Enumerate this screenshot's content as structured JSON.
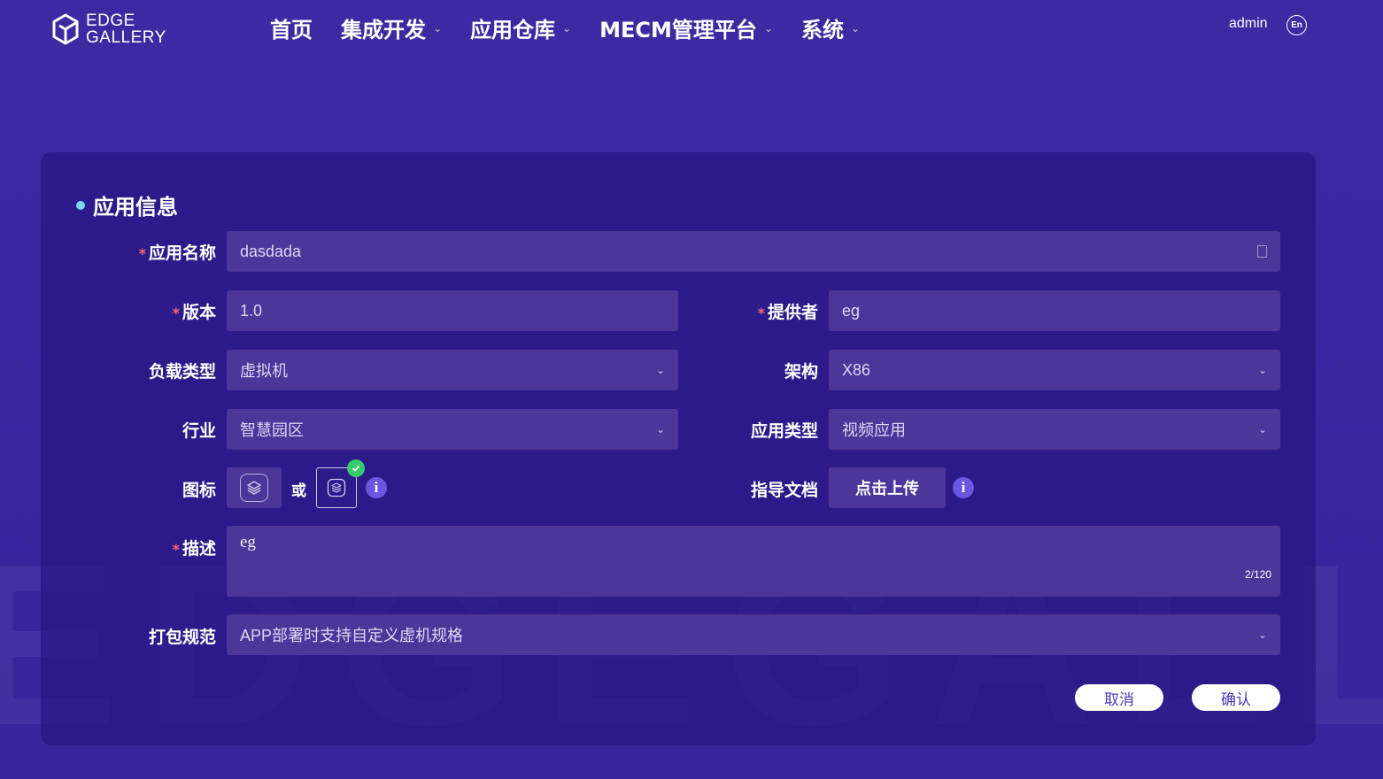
{
  "header": {
    "logo_line1": "EDGE",
    "logo_line2": "GALLERY",
    "nav": [
      {
        "label": "首页",
        "has_dropdown": false
      },
      {
        "label": "集成开发",
        "has_dropdown": true
      },
      {
        "label": "应用仓库",
        "has_dropdown": true
      },
      {
        "label": "MECM管理平台",
        "has_dropdown": true
      },
      {
        "label": "系统",
        "has_dropdown": true
      }
    ],
    "user": "admin",
    "lang": "En"
  },
  "form": {
    "section_title": "应用信息",
    "app_name": {
      "label": "应用名称",
      "value": "dasdada",
      "required": true
    },
    "version": {
      "label": "版本",
      "value": "1.0",
      "required": true
    },
    "provider": {
      "label": "提供者",
      "value": "eg",
      "required": true
    },
    "workload_type": {
      "label": "负载类型",
      "value": "虚拟机"
    },
    "architecture": {
      "label": "架构",
      "value": "X86"
    },
    "industry": {
      "label": "行业",
      "value": "智慧园区"
    },
    "app_type": {
      "label": "应用类型",
      "value": "视频应用"
    },
    "icon": {
      "label": "图标",
      "or": "或"
    },
    "guide_doc": {
      "label": "指导文档",
      "upload_label": "点击上传"
    },
    "description": {
      "label": "描述",
      "value": "eg",
      "counter": "2/120",
      "required": true
    },
    "packaging": {
      "label": "打包规范",
      "value": "APP部署时支持自定义虚机规格"
    },
    "required_mark": "*"
  },
  "actions": {
    "cancel": "取消",
    "confirm": "确认"
  },
  "colors": {
    "background": "#3d2aa3",
    "card": "#28168a",
    "field": "#4c369a",
    "accent_dot": "#7ad6f0",
    "required": "#f56c6c",
    "success": "#37c96e",
    "info": "#6a56e0"
  }
}
